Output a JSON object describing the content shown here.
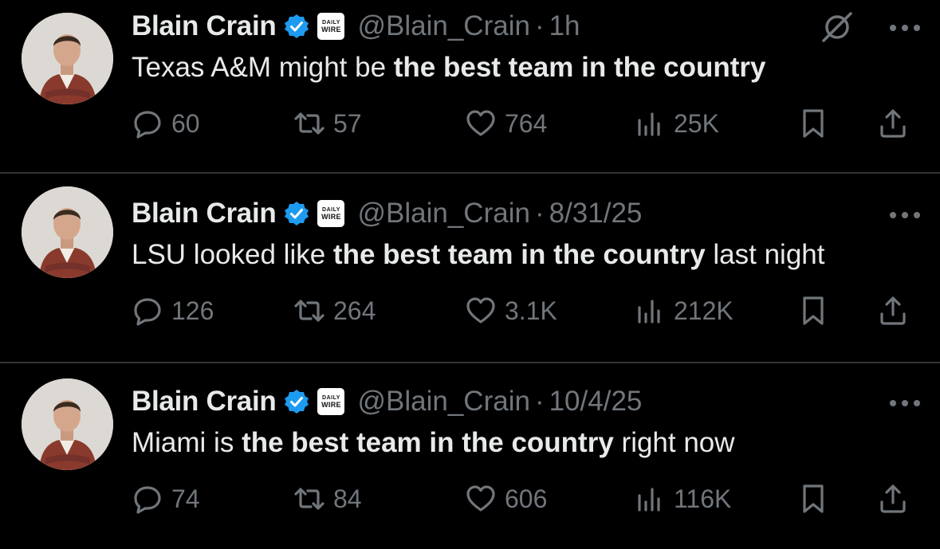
{
  "tweets": [
    {
      "name": "Blain Crain",
      "affiliation": {
        "line1": "DAILY",
        "line2": "WIRE"
      },
      "handle": "@Blain_Crain",
      "separator": "·",
      "time": "1h",
      "text_parts": [
        "Texas A&M might be ",
        "the best team in the country",
        ""
      ],
      "replies": "60",
      "reposts": "57",
      "likes": "764",
      "views": "25K",
      "show_grok": true
    },
    {
      "name": "Blain Crain",
      "affiliation": {
        "line1": "DAILY",
        "line2": "WIRE"
      },
      "handle": "@Blain_Crain",
      "separator": "·",
      "time": "8/31/25",
      "text_parts": [
        "LSU looked like ",
        "the best team in the country",
        " last night"
      ],
      "replies": "126",
      "reposts": "264",
      "likes": "3.1K",
      "views": "212K",
      "show_grok": false
    },
    {
      "name": "Blain Crain",
      "affiliation": {
        "line1": "DAILY",
        "line2": "WIRE"
      },
      "handle": "@Blain_Crain",
      "separator": "·",
      "time": "10/4/25",
      "text_parts": [
        "Miami is ",
        "the best team in the country",
        " right now"
      ],
      "replies": "74",
      "reposts": "84",
      "likes": "606",
      "views": "116K",
      "show_grok": false
    }
  ],
  "icons": {
    "verified": "verified-badge-icon",
    "grok": "grok-icon",
    "more": "more-options-icon",
    "reply": "reply-icon",
    "repost": "repost-icon",
    "like": "like-icon",
    "views": "views-icon",
    "bookmark": "bookmark-icon",
    "share": "share-icon"
  },
  "colors": {
    "background": "#000000",
    "text": "#e7e9ea",
    "muted": "#71767b",
    "verified": "#1d9bf0",
    "divider": "#2f3336"
  }
}
